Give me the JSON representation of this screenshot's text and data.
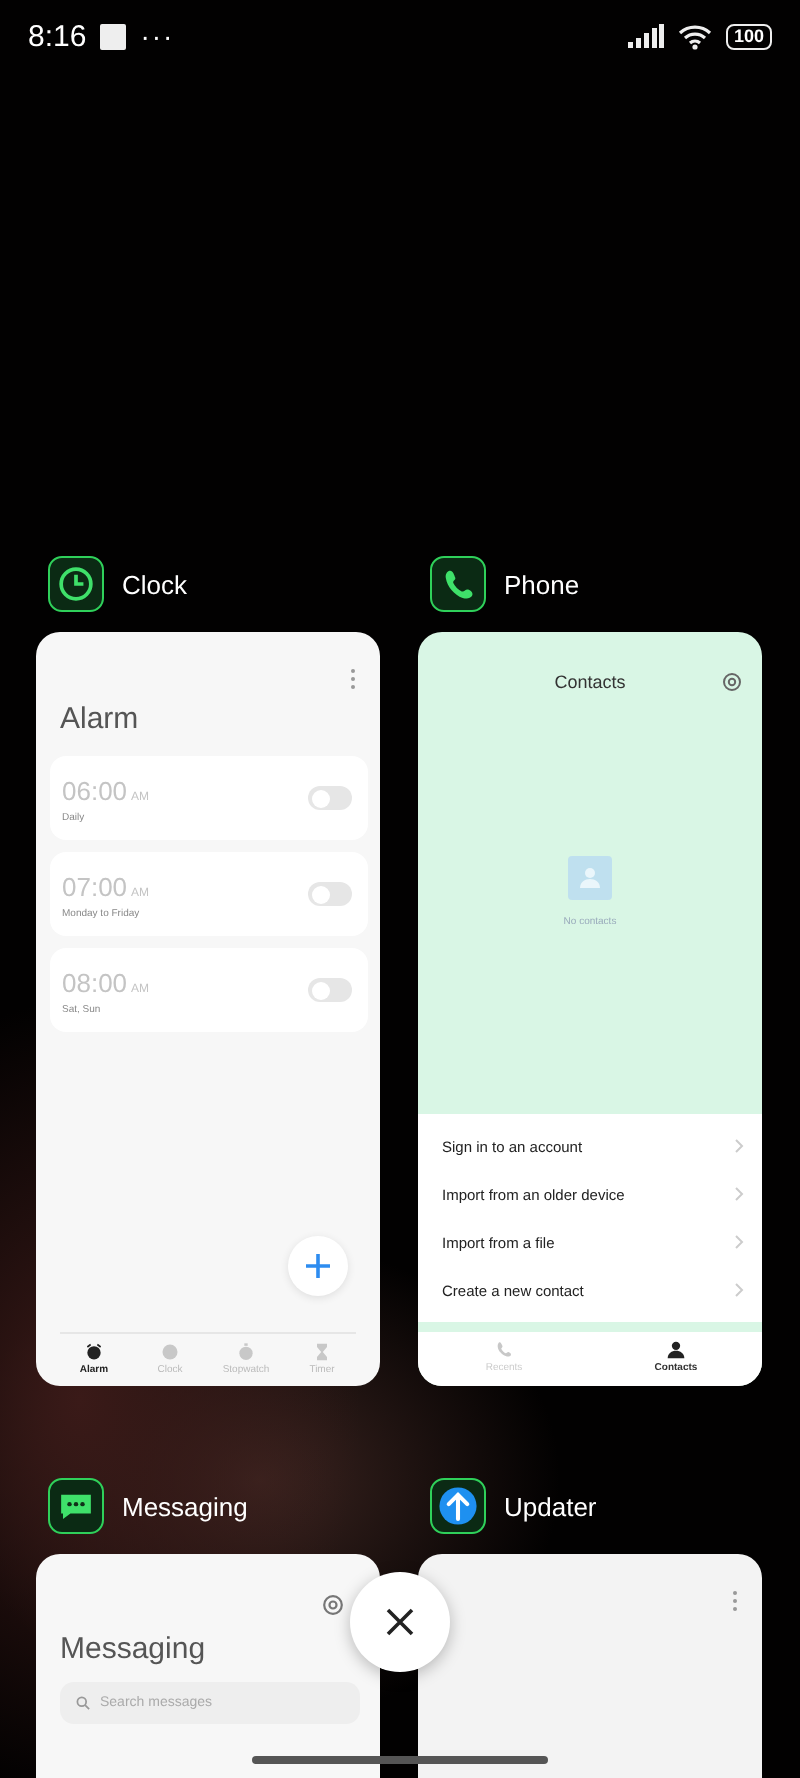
{
  "status_bar": {
    "time": "8:16",
    "overflow": "···",
    "battery": "100"
  },
  "apps": [
    {
      "name": "Clock",
      "kind": "clock",
      "card": {
        "kind": "alarms",
        "title": "Alarm",
        "alarms": [
          {
            "time": "06:00",
            "period": "AM",
            "repeat": "Daily",
            "on": false
          },
          {
            "time": "07:00",
            "period": "AM",
            "repeat": "Monday to Friday",
            "on": false
          },
          {
            "time": "08:00",
            "period": "AM",
            "repeat": "Sat, Sun",
            "on": false
          }
        ],
        "tabs": [
          {
            "label": "Alarm",
            "kind": "alarm",
            "selected": true
          },
          {
            "label": "Clock",
            "kind": "clock",
            "selected": false
          },
          {
            "label": "Stopwatch",
            "kind": "stopwatch",
            "selected": false
          },
          {
            "label": "Timer",
            "kind": "timer",
            "selected": false
          }
        ]
      }
    },
    {
      "name": "Phone",
      "kind": "phone",
      "card": {
        "kind": "contacts",
        "title": "Contacts",
        "empty": "No contacts",
        "actions": [
          "Sign in to an account",
          "Import from an older device",
          "Import from a file",
          "Create a new contact"
        ],
        "tabs": [
          {
            "label": "Recents",
            "kind": "phone",
            "selected": false
          },
          {
            "label": "Contacts",
            "kind": "person",
            "selected": true
          }
        ]
      }
    },
    {
      "name": "Messaging",
      "kind": "message",
      "card": {
        "kind": "messaging",
        "title": "Messaging",
        "search": {
          "placeholder": "Search messages"
        }
      }
    },
    {
      "name": "Updater",
      "kind": "updater",
      "card": {
        "kind": "blank"
      }
    }
  ]
}
